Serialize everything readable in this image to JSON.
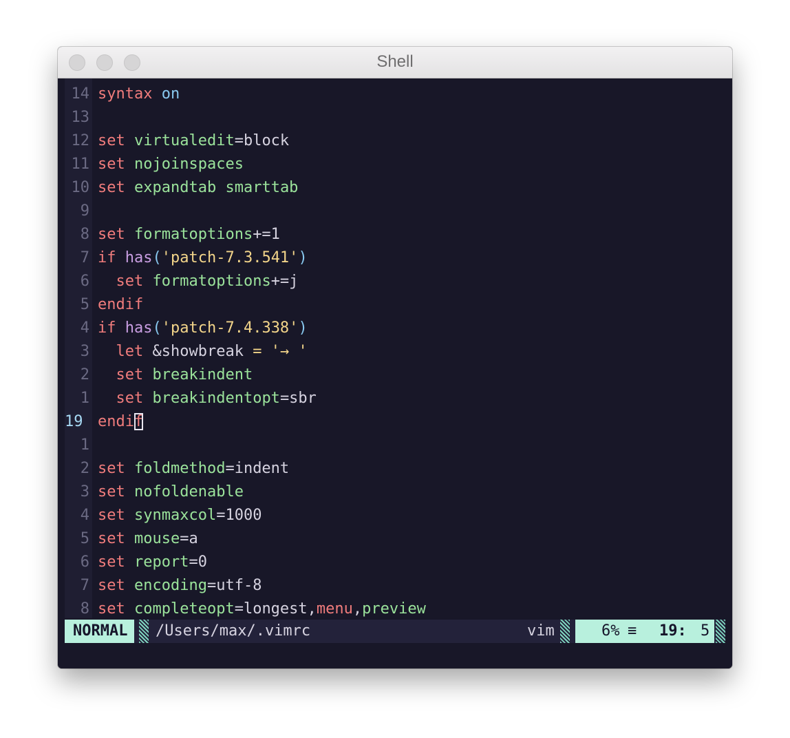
{
  "window": {
    "title": "Shell"
  },
  "editor": {
    "lines": [
      {
        "num": "14",
        "segs": [
          {
            "t": "syntax",
            "c": "k"
          },
          {
            "t": " "
          },
          {
            "t": "on",
            "c": "p"
          }
        ]
      },
      {
        "num": "13",
        "segs": []
      },
      {
        "num": "12",
        "segs": [
          {
            "t": "set",
            "c": "k"
          },
          {
            "t": " "
          },
          {
            "t": "virtualedit",
            "c": "o"
          },
          {
            "t": "=block",
            "c": "n"
          }
        ]
      },
      {
        "num": "11",
        "segs": [
          {
            "t": "set",
            "c": "k"
          },
          {
            "t": " "
          },
          {
            "t": "nojoinspaces",
            "c": "o"
          }
        ]
      },
      {
        "num": "10",
        "segs": [
          {
            "t": "set",
            "c": "k"
          },
          {
            "t": " "
          },
          {
            "t": "expandtab",
            "c": "o"
          },
          {
            "t": " "
          },
          {
            "t": "smarttab",
            "c": "o"
          }
        ]
      },
      {
        "num": "9",
        "segs": []
      },
      {
        "num": "8",
        "segs": [
          {
            "t": "set",
            "c": "k"
          },
          {
            "t": " "
          },
          {
            "t": "formatoptions",
            "c": "o"
          },
          {
            "t": "+=1",
            "c": "n"
          }
        ]
      },
      {
        "num": "7",
        "segs": [
          {
            "t": "if",
            "c": "k"
          },
          {
            "t": " "
          },
          {
            "t": "has",
            "c": "f"
          },
          {
            "t": "(",
            "c": "p"
          },
          {
            "t": "'patch-7.3.541'",
            "c": "s"
          },
          {
            "t": ")",
            "c": "p"
          }
        ]
      },
      {
        "num": "6",
        "segs": [
          {
            "t": "  "
          },
          {
            "t": "set",
            "c": "k"
          },
          {
            "t": " "
          },
          {
            "t": "formatoptions",
            "c": "o"
          },
          {
            "t": "+=j",
            "c": "n"
          }
        ]
      },
      {
        "num": "5",
        "segs": [
          {
            "t": "endif",
            "c": "k"
          }
        ]
      },
      {
        "num": "4",
        "segs": [
          {
            "t": "if",
            "c": "k"
          },
          {
            "t": " "
          },
          {
            "t": "has",
            "c": "f"
          },
          {
            "t": "(",
            "c": "p"
          },
          {
            "t": "'patch-7.4.338'",
            "c": "s"
          },
          {
            "t": ")",
            "c": "p"
          }
        ]
      },
      {
        "num": "3",
        "segs": [
          {
            "t": "  "
          },
          {
            "t": "let",
            "c": "k"
          },
          {
            "t": " "
          },
          {
            "t": "&showbreak",
            "c": "n"
          },
          {
            "t": " "
          },
          {
            "t": "=",
            "c": "s"
          },
          {
            "t": " "
          },
          {
            "t": "'→ '",
            "c": "s"
          }
        ]
      },
      {
        "num": "2",
        "segs": [
          {
            "t": "  "
          },
          {
            "t": "set",
            "c": "k"
          },
          {
            "t": " "
          },
          {
            "t": "breakindent",
            "c": "o"
          }
        ]
      },
      {
        "num": "1",
        "segs": [
          {
            "t": "  "
          },
          {
            "t": "set",
            "c": "k"
          },
          {
            "t": " "
          },
          {
            "t": "breakindentopt",
            "c": "o"
          },
          {
            "t": "=sbr",
            "c": "n"
          }
        ]
      },
      {
        "num": "19",
        "current": true,
        "segs": [
          {
            "t": "endi",
            "c": "k"
          },
          {
            "t": "f",
            "c": "k",
            "cursor": true
          }
        ]
      },
      {
        "num": "1",
        "segs": []
      },
      {
        "num": "2",
        "segs": [
          {
            "t": "set",
            "c": "k"
          },
          {
            "t": " "
          },
          {
            "t": "foldmethod",
            "c": "o"
          },
          {
            "t": "=indent",
            "c": "n"
          }
        ]
      },
      {
        "num": "3",
        "segs": [
          {
            "t": "set",
            "c": "k"
          },
          {
            "t": " "
          },
          {
            "t": "nofoldenable",
            "c": "o"
          }
        ]
      },
      {
        "num": "4",
        "segs": [
          {
            "t": "set",
            "c": "k"
          },
          {
            "t": " "
          },
          {
            "t": "synmaxcol",
            "c": "o"
          },
          {
            "t": "=1000",
            "c": "n"
          }
        ]
      },
      {
        "num": "5",
        "segs": [
          {
            "t": "set",
            "c": "k"
          },
          {
            "t": " "
          },
          {
            "t": "mouse",
            "c": "o"
          },
          {
            "t": "=a",
            "c": "n"
          }
        ]
      },
      {
        "num": "6",
        "segs": [
          {
            "t": "set",
            "c": "k"
          },
          {
            "t": " "
          },
          {
            "t": "report",
            "c": "o"
          },
          {
            "t": "=0",
            "c": "n"
          }
        ]
      },
      {
        "num": "7",
        "segs": [
          {
            "t": "set",
            "c": "k"
          },
          {
            "t": " "
          },
          {
            "t": "encoding",
            "c": "o"
          },
          {
            "t": "=utf-8",
            "c": "n"
          }
        ]
      },
      {
        "num": "8",
        "segs": [
          {
            "t": "set",
            "c": "k"
          },
          {
            "t": " "
          },
          {
            "t": "completeopt",
            "c": "o"
          },
          {
            "t": "=longest,",
            "c": "n"
          },
          {
            "t": "menu",
            "c": "k"
          },
          {
            "t": ",",
            "c": "n"
          },
          {
            "t": "preview",
            "c": "o"
          }
        ]
      }
    ]
  },
  "statusline": {
    "mode": "NORMAL",
    "path": "/Users/max/.vimrc",
    "filetype": "vim",
    "percent": "6%",
    "line": "19:",
    "col": "5"
  },
  "colors": {
    "background": "#181728",
    "keyword": "#f07c7c",
    "option": "#9be39b",
    "string": "#f3d58a",
    "function": "#c99ee2",
    "paren": "#88c8ef",
    "status_accent": "#b8f0dd"
  }
}
